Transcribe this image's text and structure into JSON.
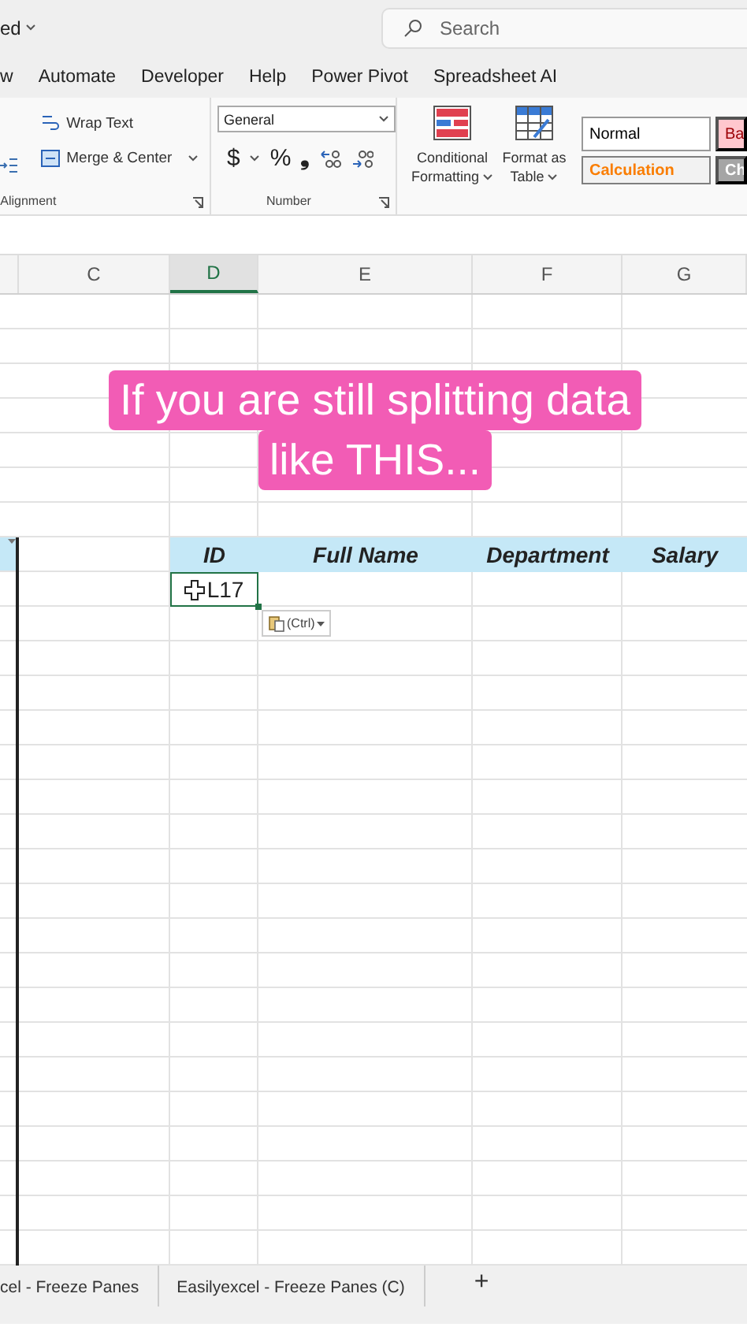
{
  "title_bar": {
    "title": "ed",
    "search": {
      "placeholder": "Search"
    }
  },
  "menu_tabs": [
    {
      "label": "w",
      "selected": false
    },
    {
      "label": "Automate",
      "selected": false
    },
    {
      "label": "Developer",
      "selected": false
    },
    {
      "label": "Help",
      "selected": false
    },
    {
      "label": "Power Pivot",
      "selected": false
    },
    {
      "label": "Spreadsheet AI",
      "selected": false
    }
  ],
  "ribbon": {
    "alignment": {
      "buttons": [
        "Wrap Text",
        "Merge & Center"
      ],
      "label": "Alignment"
    },
    "number": {
      "format": "General",
      "symbols": [
        "$",
        "%",
        "❟"
      ],
      "label": "Number"
    },
    "styles": {
      "buttons": [
        {
          "line1": "Conditional",
          "line2": "Formatting"
        },
        {
          "line1": "Format as",
          "line2": "Table"
        }
      ],
      "cells": [
        {
          "label": "Normal",
          "kind": "normal"
        },
        {
          "label": "Ba",
          "kind": "bad"
        },
        {
          "label": "Calculation",
          "kind": "calculation"
        },
        {
          "label": "Ch",
          "kind": "check"
        }
      ]
    }
  },
  "columns": [
    {
      "label": "C",
      "selected": false
    },
    {
      "label": "D",
      "selected": true
    },
    {
      "label": "E",
      "selected": false
    },
    {
      "label": "F",
      "selected": false
    },
    {
      "label": "G",
      "selected": false
    }
  ],
  "table_headers": [
    "ID",
    "Full Name",
    "Department",
    "Salary"
  ],
  "active_cell": {
    "value": "L17"
  },
  "paste_options": {
    "label": "(Ctrl)"
  },
  "banner": {
    "lines": [
      "If you are still splitting data",
      "like THIS..."
    ]
  },
  "sheet_tabs": [
    {
      "label": "cel - Freeze Panes",
      "selected": false
    },
    {
      "label": "Easilyexcel - Freeze Panes (C)",
      "selected": false
    }
  ],
  "add_sheet": "+"
}
